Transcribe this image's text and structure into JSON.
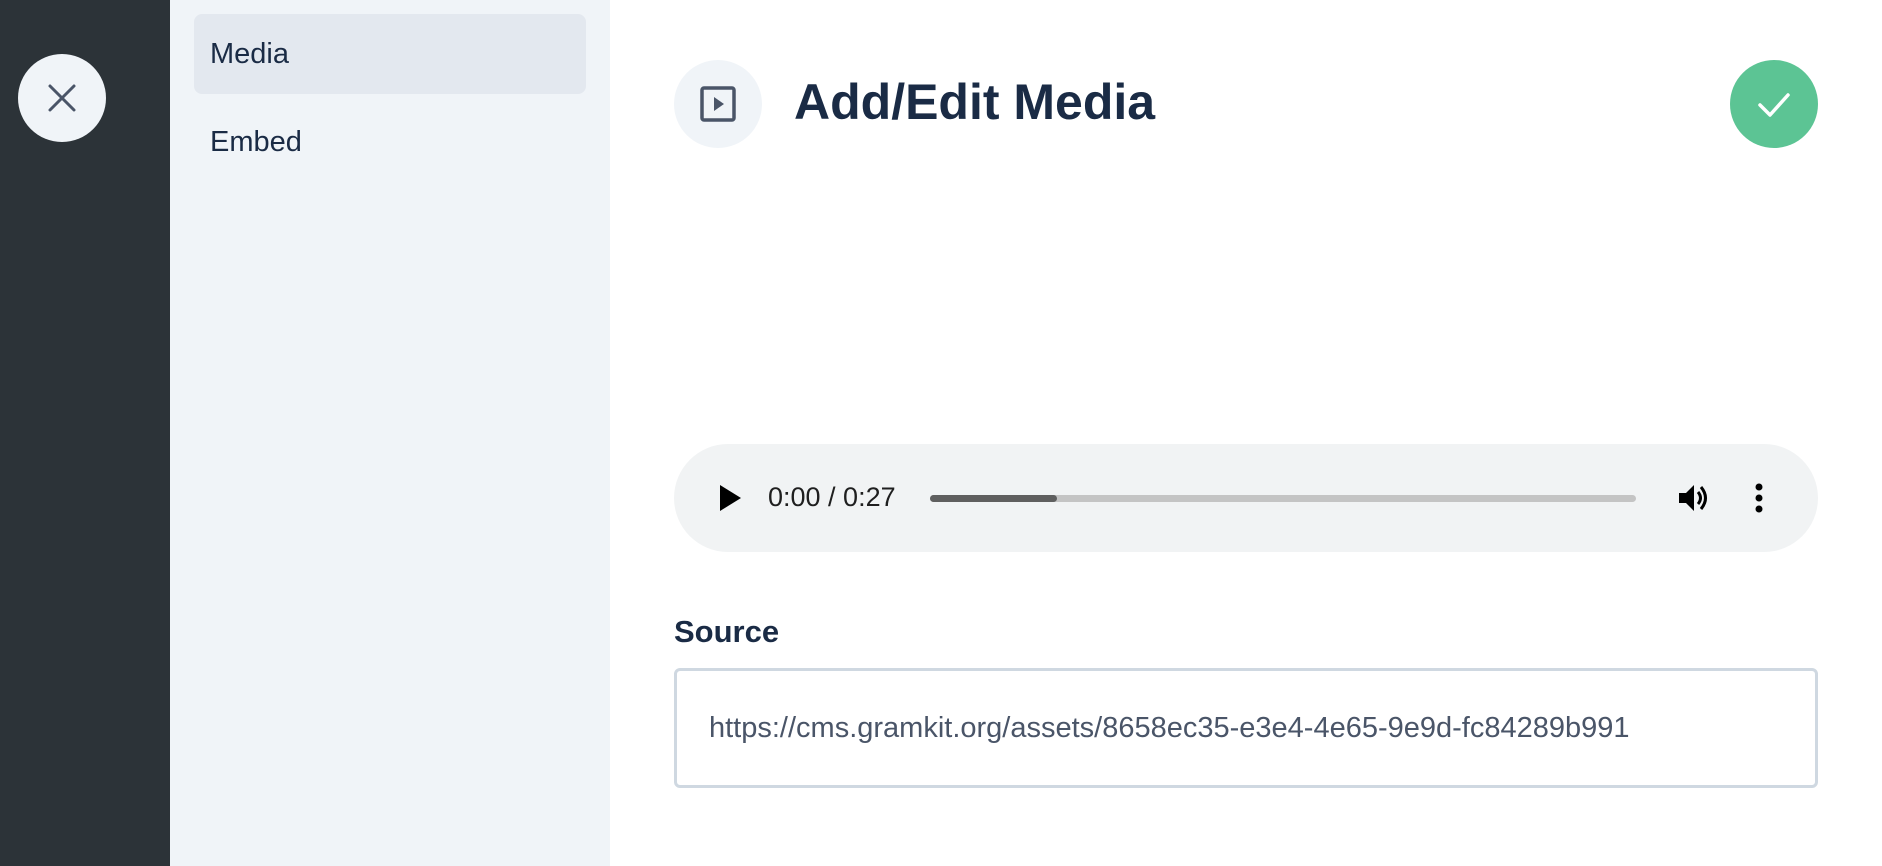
{
  "sidebar": {
    "items": [
      {
        "label": "Media",
        "active": true
      },
      {
        "label": "Embed",
        "active": false
      }
    ]
  },
  "header": {
    "title": "Add/Edit Media",
    "type_icon": "play-square-icon",
    "confirm_icon": "checkmark-icon",
    "close_icon": "close-icon"
  },
  "audio": {
    "time": "0:00 / 0:27",
    "progress_fraction": 0.18
  },
  "source": {
    "label": "Source",
    "value": "https://cms.gramkit.org/assets/8658ec35-e3e4-4e65-9e9d-fc84289b991"
  },
  "colors": {
    "rail": "#2c3338",
    "sidebar": "#f0f4f8",
    "confirm": "#5cc494",
    "text": "#1a2b45"
  }
}
